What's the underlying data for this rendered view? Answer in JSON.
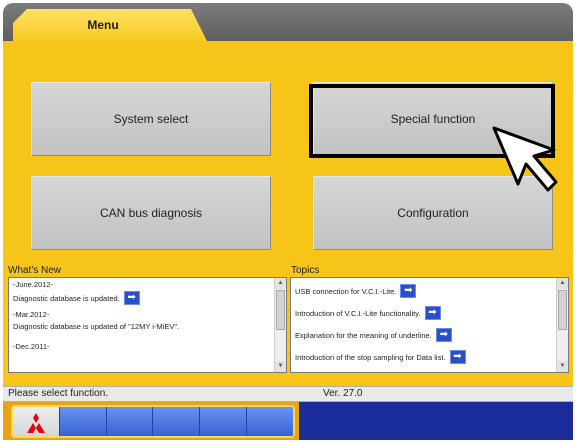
{
  "tab": {
    "label": "Menu"
  },
  "buttons": {
    "system_select": "System select",
    "special_function": "Special function",
    "can_bus_diagnosis": "CAN bus diagnosis",
    "configuration": "Configuration"
  },
  "whats_new": {
    "title": "What's New",
    "lines": [
      "-June.2012-",
      "Diagnostic database is updated.",
      "-Mar.2012-",
      "Diagnostic database is updated of \"12MY i-MiEV\".",
      "-Dec.2011-"
    ]
  },
  "topics": {
    "title": "Topics",
    "items": [
      "USB connection for V.C.I.-Lite.",
      "Introduction of V.C.I.-Lite functionality.",
      "Explanation for the meaning of underline.",
      "Introduction of the stop sampling for Data list."
    ]
  },
  "status": {
    "message": "Please select function.",
    "version": "Ver. 27.0"
  },
  "colors": {
    "main_background": "#f7c518",
    "button_gray": "#c8c8c8",
    "highlight": "#000000",
    "link_arrow": "#2a4fc8",
    "toolbar_blue": "#1a2b9a",
    "logo_red": "#e60012"
  },
  "icons": {
    "cursor": "pointer-cursor-icon",
    "link": "right-arrow-icon",
    "logo": "three-diamonds-logo"
  }
}
